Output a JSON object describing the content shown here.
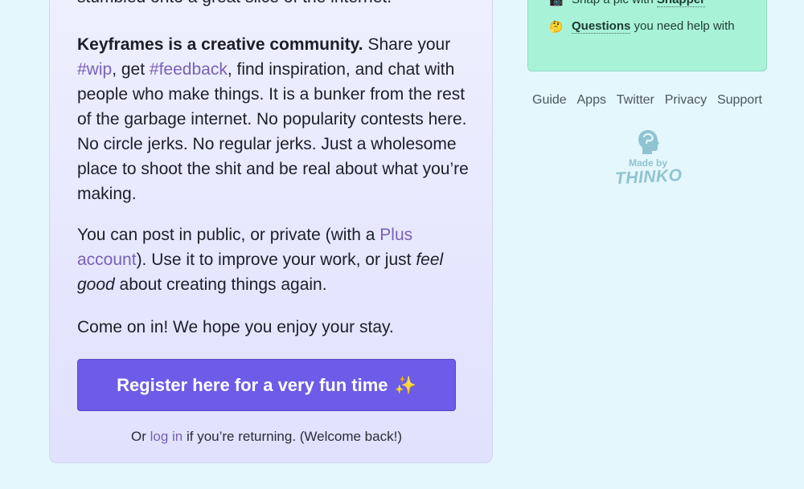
{
  "main": {
    "intro_fragment": "stumbled onto a great slice of the internet.",
    "p1": {
      "strong": "Keyframes is a creative community.",
      "t1": " Share your ",
      "tag_wip": "#wip",
      "t2": ", get ",
      "tag_feedback": "#feedback",
      "t3": ", find inspiration, and chat with people who make things. It is a bunker from the rest of the garbage internet. No popularity contests here. No circle jerks. No regular jerks. Just a wholesome place to shoot the shit and be real about what you’re making."
    },
    "p2": {
      "t1": "You can post in public, or private (with a ",
      "plus_link": "Plus account",
      "t2": "). Use it to improve your work, or just ",
      "em1": "feel good",
      "t3": " about creating things again."
    },
    "p3": "Come on in! We hope you enjoy your stay.",
    "cta": {
      "label": "Register here for a very fun time",
      "sparkle": "✨"
    },
    "login": {
      "pre": "Or ",
      "link": "log in",
      "post": " if you’re returning. (Welcome back!)"
    }
  },
  "sidebar": {
    "items": [
      {
        "emoji": "📷",
        "text": "Snap a pic with ",
        "lead": "Snapper"
      },
      {
        "emoji": "🤔",
        "lead": "Questions",
        "text": " you need help with"
      }
    ]
  },
  "footer": {
    "links": [
      "Guide",
      "Apps",
      "Twitter",
      "Privacy",
      "Support"
    ]
  },
  "madeby": {
    "label": "Made by",
    "brand": "THINKO"
  },
  "colors": {
    "background": "#e4f7fc",
    "card": "#e7e8fd",
    "accent": "#6c5ce7",
    "link": "#7a5fb8",
    "side_card": "#a8f3d8"
  }
}
